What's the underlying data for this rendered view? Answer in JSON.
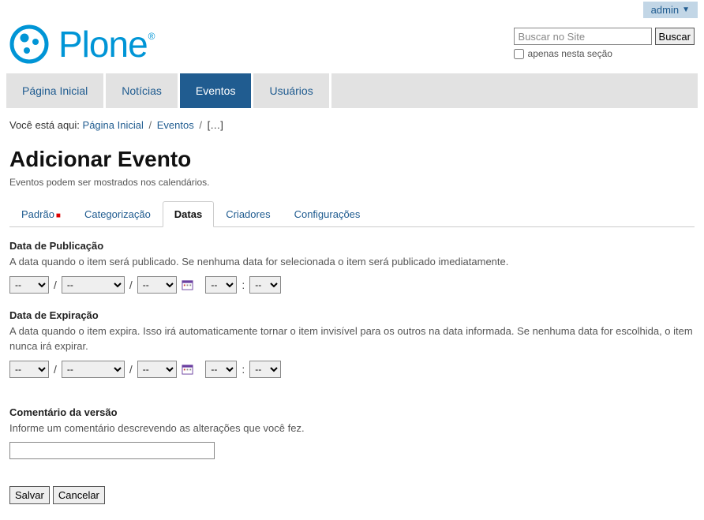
{
  "admin": {
    "label": "admin"
  },
  "logo": {
    "text": "Plone"
  },
  "search": {
    "placeholder": "Buscar no Site",
    "button": "Buscar",
    "only_section": "apenas nesta seção"
  },
  "nav": {
    "items": [
      {
        "label": "Página Inicial"
      },
      {
        "label": "Notícias"
      },
      {
        "label": "Eventos",
        "active": true
      },
      {
        "label": "Usuários"
      }
    ]
  },
  "breadcrumb": {
    "prefix": "Você está aqui:",
    "items": [
      "Página Inicial",
      "Eventos",
      "[…]"
    ]
  },
  "page": {
    "title": "Adicionar Evento",
    "desc": "Eventos podem ser mostrados nos calendários."
  },
  "tabs": [
    {
      "label": "Padrão",
      "required": true
    },
    {
      "label": "Categorização"
    },
    {
      "label": "Datas",
      "active": true
    },
    {
      "label": "Criadores"
    },
    {
      "label": "Configurações"
    }
  ],
  "fields": {
    "pub": {
      "label": "Data de Publicação",
      "help": "A data quando o item será publicado. Se nenhuma data for selecionada o item será publicado imediatamente.",
      "day": "--",
      "month": "--",
      "year": "--",
      "hour": "--",
      "min": "--"
    },
    "exp": {
      "label": "Data de Expiração",
      "help": "A data quando o item expira. Isso irá automaticamente tornar o item invisível para os outros na data informada. Se nenhuma data for escolhida, o item nunca irá expirar.",
      "day": "--",
      "month": "--",
      "year": "--",
      "hour": "--",
      "min": "--"
    },
    "comment": {
      "label": "Comentário da versão",
      "help": "Informe um comentário descrevendo as alterações que você fez.",
      "value": ""
    }
  },
  "buttons": {
    "save": "Salvar",
    "cancel": "Cancelar"
  }
}
